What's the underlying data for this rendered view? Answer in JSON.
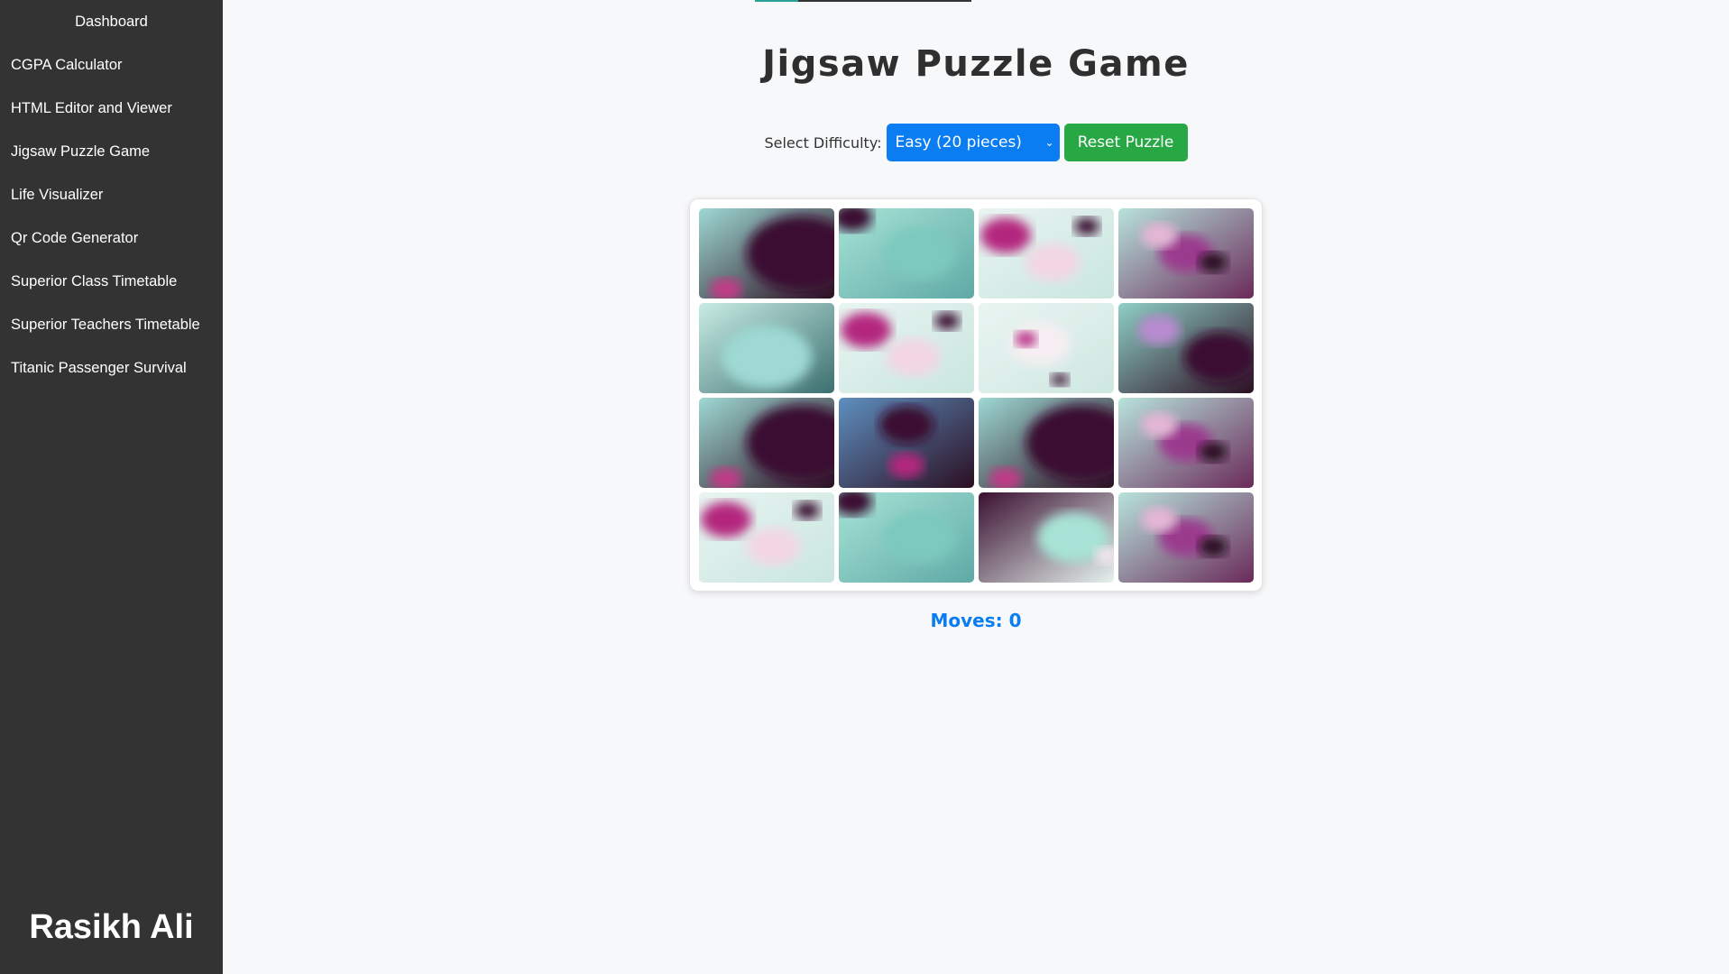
{
  "sidebar": {
    "items": [
      {
        "label": "Dashboard"
      },
      {
        "label": "CGPA Calculator"
      },
      {
        "label": "HTML Editor and Viewer"
      },
      {
        "label": "Jigsaw Puzzle Game"
      },
      {
        "label": "Life Visualizer"
      },
      {
        "label": "Qr Code Generator"
      },
      {
        "label": "Superior Class Timetable"
      },
      {
        "label": "Superior Teachers Timetable"
      },
      {
        "label": "Titanic Passenger Survival"
      }
    ],
    "brand": "Rasikh Ali"
  },
  "main": {
    "title": "Jigsaw Puzzle Game",
    "difficulty_label": "Select Difficulty:",
    "difficulty_selected": "Easy (20 pieces)",
    "reset_label": "Reset Puzzle",
    "moves_text": "Moves: 0"
  },
  "colors": {
    "sidebar_bg": "#333333",
    "select_bg": "#0b7df3",
    "reset_bg": "#28a745",
    "moves_color": "#0b7df3",
    "page_bg": "#f7f8fa"
  },
  "puzzle": {
    "rows": 4,
    "cols": 4,
    "pieces": [
      {
        "theme": "dark-teal"
      },
      {
        "theme": "mint"
      },
      {
        "theme": "pink-blossom"
      },
      {
        "theme": "blossom-branch"
      },
      {
        "theme": "mint-pale"
      },
      {
        "theme": "pink-blossom"
      },
      {
        "theme": "white-blossom"
      },
      {
        "theme": "teal-dark-blossom"
      },
      {
        "theme": "dark-teal"
      },
      {
        "theme": "teal-magenta"
      },
      {
        "theme": "dark-teal"
      },
      {
        "theme": "blossom-branch"
      },
      {
        "theme": "pink-blossom"
      },
      {
        "theme": "mint"
      },
      {
        "theme": "dark-pale"
      },
      {
        "theme": "blossom-branch"
      }
    ]
  }
}
